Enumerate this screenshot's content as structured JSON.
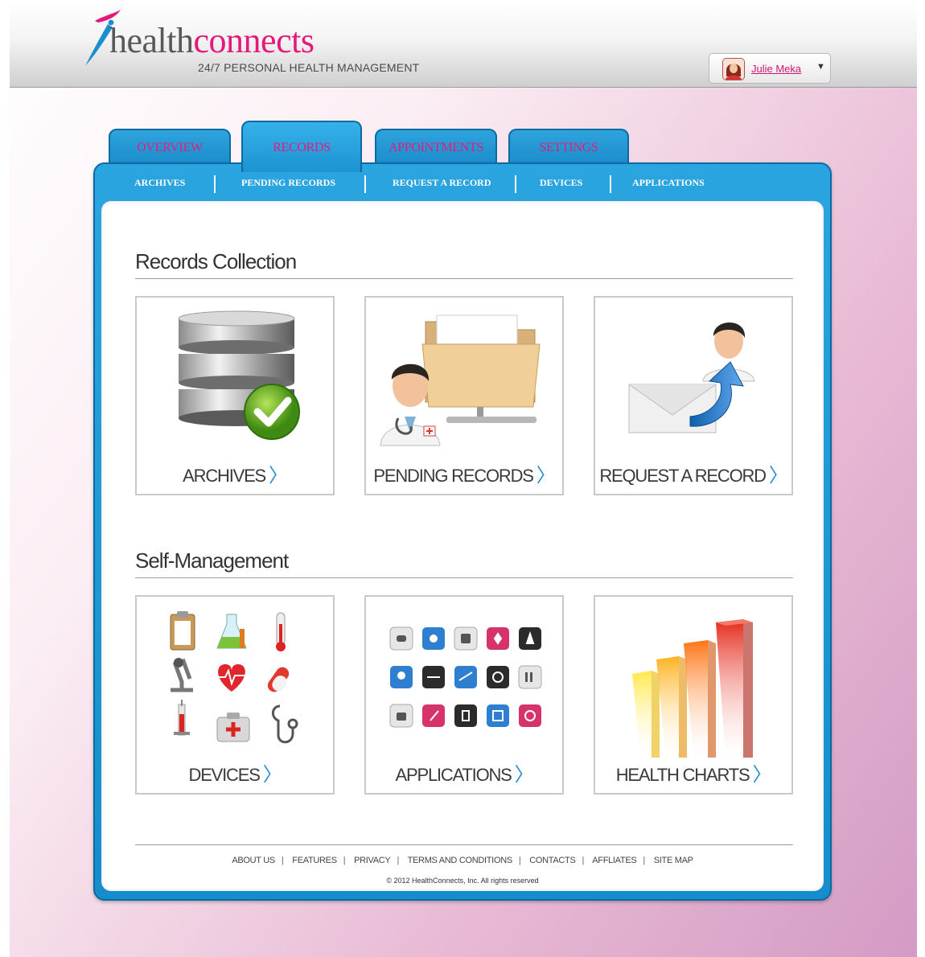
{
  "brand": {
    "logo_prefix": "health",
    "logo_suffix": "connects",
    "tagline": "24/7 PERSONAL HEALTH MANAGEMENT",
    "pink": "#e5197b",
    "blue": "#1c93d2"
  },
  "user": {
    "name": "Julie Meka",
    "caret": "▼"
  },
  "tabs": [
    {
      "label": "OVERVIEW",
      "active": false
    },
    {
      "label": "RECORDS",
      "active": true
    },
    {
      "label": "APPOINTMENTS",
      "active": false
    },
    {
      "label": "SETTINGS",
      "active": false
    }
  ],
  "subnav": [
    "ARCHIVES",
    "PENDING RECORDS",
    "REQUEST A RECORD",
    "DEVICES",
    "APPLICATIONS"
  ],
  "sections": [
    {
      "title": "Records Collection",
      "cards": [
        {
          "label": "ARCHIVES",
          "icon": "database-check-icon"
        },
        {
          "label": "PENDING RECORDS",
          "icon": "doctor-folder-icon"
        },
        {
          "label": "REQUEST A RECORD",
          "icon": "doctor-envelope-arrow-icon"
        }
      ]
    },
    {
      "title": "Self-Management",
      "cards": [
        {
          "label": "DEVICES",
          "icon": "medical-devices-grid-icon"
        },
        {
          "label": "APPLICATIONS",
          "icon": "app-icons-grid-icon"
        },
        {
          "label": "HEALTH CHARTS",
          "icon": "3d-bar-chart-icon"
        }
      ]
    }
  ],
  "chevron": "〉",
  "footer": {
    "links": [
      "ABOUT US",
      "FEATURES",
      "PRIVACY",
      "TERMS AND CONDITIONS",
      "CONTACTS",
      "AFFLIATES",
      "SITE MAP"
    ],
    "separator": "|",
    "copyright": "2012 HealthConnects, Inc.  All rights reserved"
  }
}
